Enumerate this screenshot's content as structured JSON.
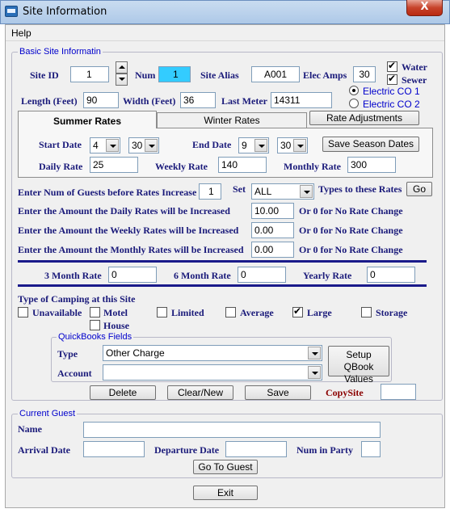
{
  "window": {
    "title": "Site Information",
    "close_label": "X"
  },
  "menu": {
    "help": "Help"
  },
  "basic": {
    "legend": "Basic Site Informatin",
    "site_id_label": "Site ID",
    "site_id": "1",
    "num_label": "Num",
    "num": "1",
    "site_alias_label": "Site Alias",
    "site_alias": "A001",
    "elec_amps_label": "Elec Amps",
    "elec_amps": "30",
    "water_label": "Water",
    "water_checked": true,
    "sewer_label": "Sewer",
    "sewer_checked": true,
    "length_label": "Length (Feet)",
    "length": "90",
    "width_label": "Width (Feet)",
    "width": "36",
    "last_meter_label": "Last Meter",
    "last_meter": "14311",
    "electric1_label": "Electric CO 1",
    "electric2_label": "Electric CO 2",
    "electric_selected": 1
  },
  "tabs": {
    "summer": "Summer Rates",
    "winter": "Winter Rates",
    "rate_adjustments": "Rate Adjustments"
  },
  "season": {
    "start_date_label": "Start Date",
    "start_month": "4",
    "start_day": "30",
    "end_date_label": "End Date",
    "end_month": "9",
    "end_day": "30",
    "save_dates": "Save Season Dates",
    "daily_rate_label": "Daily Rate",
    "daily_rate": "25",
    "weekly_rate_label": "Weekly Rate",
    "weekly_rate": "140",
    "monthly_rate_label": "Monthly Rate",
    "monthly_rate": "300"
  },
  "increase": {
    "guests_label": "Enter Num of Guests before Rates Increase",
    "guests": "1",
    "set_label": "Set",
    "set_value": "ALL",
    "types_label": "Types to these Rates",
    "go": "Go",
    "daily_label": "Enter the Amount the Daily Rates will be Increased",
    "daily": "10.00",
    "weekly_label": "Enter the Amount the Weekly Rates will be Increased",
    "weekly": "0.00",
    "monthly_label": "Enter the Amount the Monthly Rates will be Increased",
    "monthly": "0.00",
    "no_change_note": "Or 0 for No Rate Change"
  },
  "long_rates": {
    "three_month_label": "3 Month Rate",
    "three_month": "0",
    "six_month_label": "6 Month Rate",
    "six_month": "0",
    "yearly_label": "Yearly Rate",
    "yearly": "0"
  },
  "camping": {
    "title": "Type of Camping at this Site",
    "types": [
      {
        "label": "Unavailable",
        "checked": false
      },
      {
        "label": "Motel",
        "checked": false
      },
      {
        "label": "Limited",
        "checked": false
      },
      {
        "label": "Average",
        "checked": false
      },
      {
        "label": "Large",
        "checked": true
      },
      {
        "label": "Storage",
        "checked": false
      },
      {
        "label": "House",
        "checked": false
      }
    ]
  },
  "quickbooks": {
    "legend": "QuickBooks Fields",
    "type_label": "Type",
    "type_value": "Other Charge",
    "account_label": "Account",
    "account_value": "",
    "setup_button": "Setup QBook Values"
  },
  "actions": {
    "delete": "Delete",
    "clear_new": "Clear/New",
    "save": "Save",
    "copy_site_label": "CopySite",
    "copy_site_value": ""
  },
  "guest": {
    "legend": "Current Guest",
    "name_label": "Name",
    "name": "",
    "arrival_label": "Arrival Date",
    "arrival": "",
    "departure_label": "Departure Date",
    "departure": "",
    "num_party_label": "Num in Party",
    "num_party": "",
    "go_to_guest": "Go To Guest"
  },
  "exit": "Exit"
}
